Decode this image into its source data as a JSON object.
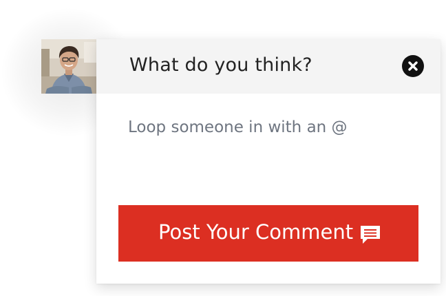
{
  "avatar": {
    "alt": "User avatar"
  },
  "header": {
    "title": "What do you think?",
    "close_icon": "close-icon"
  },
  "comment_input": {
    "placeholder": "Loop someone in with an @",
    "value": ""
  },
  "post_button": {
    "label": "Post Your Comment",
    "icon": "comment-icon"
  },
  "colors": {
    "accent": "#dc2f22",
    "header_bg": "#f4f4f4",
    "placeholder": "#6e7580",
    "close_bg": "#111111"
  }
}
